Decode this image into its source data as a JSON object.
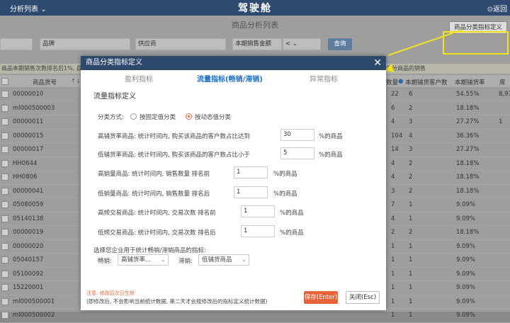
{
  "topbar": {
    "menu_label": "分析列表",
    "brand": "驾驶舱",
    "back_label": "返回"
  },
  "page": {
    "title": "商品分析列表",
    "filters": {
      "brand": "品牌",
      "supplier": "供应商",
      "sales_metric": "本期销售金额",
      "compare_op": "<",
      "query_button": "查询"
    },
    "def_button": "商品分类指标定义",
    "notice_left": "商品本期销售次数排名后1%, 且",
    "notice_right": "部分商品的销售",
    "header": {
      "goods_no": "商品货号",
      "sort": "↑↓",
      "qty": "数量",
      "cust_count": "本期铺货客户数",
      "rate": "本期铺货率",
      "more": "库"
    },
    "rows": [
      {
        "no": "00000010",
        "qty": "22",
        "cust": "6",
        "rate": "54.55%",
        "extra": "8,97"
      },
      {
        "no": "ml000500003",
        "qty": "6",
        "cust": "2",
        "rate": "18.18%",
        "extra": ""
      },
      {
        "no": "00000011",
        "qty": "4",
        "cust": "3",
        "rate": "27.27%",
        "extra": "1"
      },
      {
        "no": "00000015",
        "qty": "104",
        "cust": "4",
        "rate": "36.36%",
        "extra": ""
      },
      {
        "no": "00000017",
        "qty": "14",
        "cust": "3",
        "rate": "27.27%",
        "extra": ""
      },
      {
        "no": "HH0644",
        "qty": "4",
        "cust": "2",
        "rate": "18.18%",
        "extra": ""
      },
      {
        "no": "HH0806",
        "qty": "4",
        "cust": "2",
        "rate": "18.18%",
        "extra": ""
      },
      {
        "no": "00000041",
        "qty": "3",
        "cust": "2",
        "rate": "18.18%",
        "extra": ""
      },
      {
        "no": "05080059",
        "qty": "7",
        "cust": "1",
        "rate": "9.09%",
        "extra": ""
      },
      {
        "no": "05140138",
        "qty": "4",
        "cust": "1",
        "rate": "9.09%",
        "extra": ""
      },
      {
        "no": "00000019",
        "qty": "2",
        "cust": "2",
        "rate": "18.18%",
        "extra": ""
      },
      {
        "no": "00000020",
        "qty": "1",
        "cust": "1",
        "rate": "9.09%",
        "extra": ""
      },
      {
        "no": "05040157",
        "qty": "1",
        "cust": "1",
        "rate": "9.09%",
        "extra": ""
      },
      {
        "no": "05100092",
        "qty": "1",
        "cust": "1",
        "rate": "9.09%",
        "extra": ""
      },
      {
        "no": "15220001",
        "qty": "1",
        "cust": "1",
        "rate": "9.09%",
        "extra": ""
      },
      {
        "no": "ml000500001",
        "qty": "1",
        "cust": "1",
        "rate": "9.09%",
        "extra": ""
      },
      {
        "no": "ml000500002",
        "qty": "1",
        "cust": "1",
        "rate": "9.09%",
        "extra": ""
      }
    ]
  },
  "modal": {
    "title": "商品分类指标定义",
    "close_icon": "close-icon",
    "tabs": [
      "盈利指标",
      "流量指标(畅销/滞销)",
      "异常指标"
    ],
    "section_title": "流量指标定义",
    "method_label": "分类方式:",
    "method_fixed": "按固定值分类",
    "method_dynamic": "按动态值分类",
    "fields": [
      {
        "label": "高铺货率商品:  统计时间内, 购买该商品的客户数占比达到",
        "value": "30",
        "suffix": "%的商品"
      },
      {
        "label": "低铺货率商品:  统计时间内, 购买该商品的客户数占比小于",
        "value": "5",
        "suffix": "%的商品"
      },
      {
        "label": "高销量商品:  统计时间内, 销售数量 排名前",
        "value": "1",
        "suffix": "%的商品"
      },
      {
        "label": "低销量商品:  统计时间内, 销售数量 排名后",
        "value": "1",
        "suffix": "%的商品"
      },
      {
        "label": "高频交易商品:  统计时间内, 交易次数 排名前",
        "value": "1",
        "suffix": "%的商品"
      },
      {
        "label": "低频交易商品:  统计时间内, 交易次数 排名后",
        "value": "1",
        "suffix": "%的商品"
      }
    ],
    "choose_label": "选择您企业用于统计畅销/滞销商品的指标:",
    "hot_label": "畅销:",
    "hot_value": "高铺货率...",
    "slow_label": "滞销:",
    "slow_value": "低铺货商品",
    "note_warn": "注意: 修改后次日生效",
    "note_detail": "(即修改后, 不会影响当前统计数据, 第二天才会按修改后的指标定义统计数据)",
    "save_button": "保存(Enter)",
    "close_button": "关闭(Esc)"
  },
  "colors": {
    "header": "#2e496c",
    "accent": "#1a6fc4",
    "save": "#e8633a",
    "highlight": "#f2e21c"
  }
}
